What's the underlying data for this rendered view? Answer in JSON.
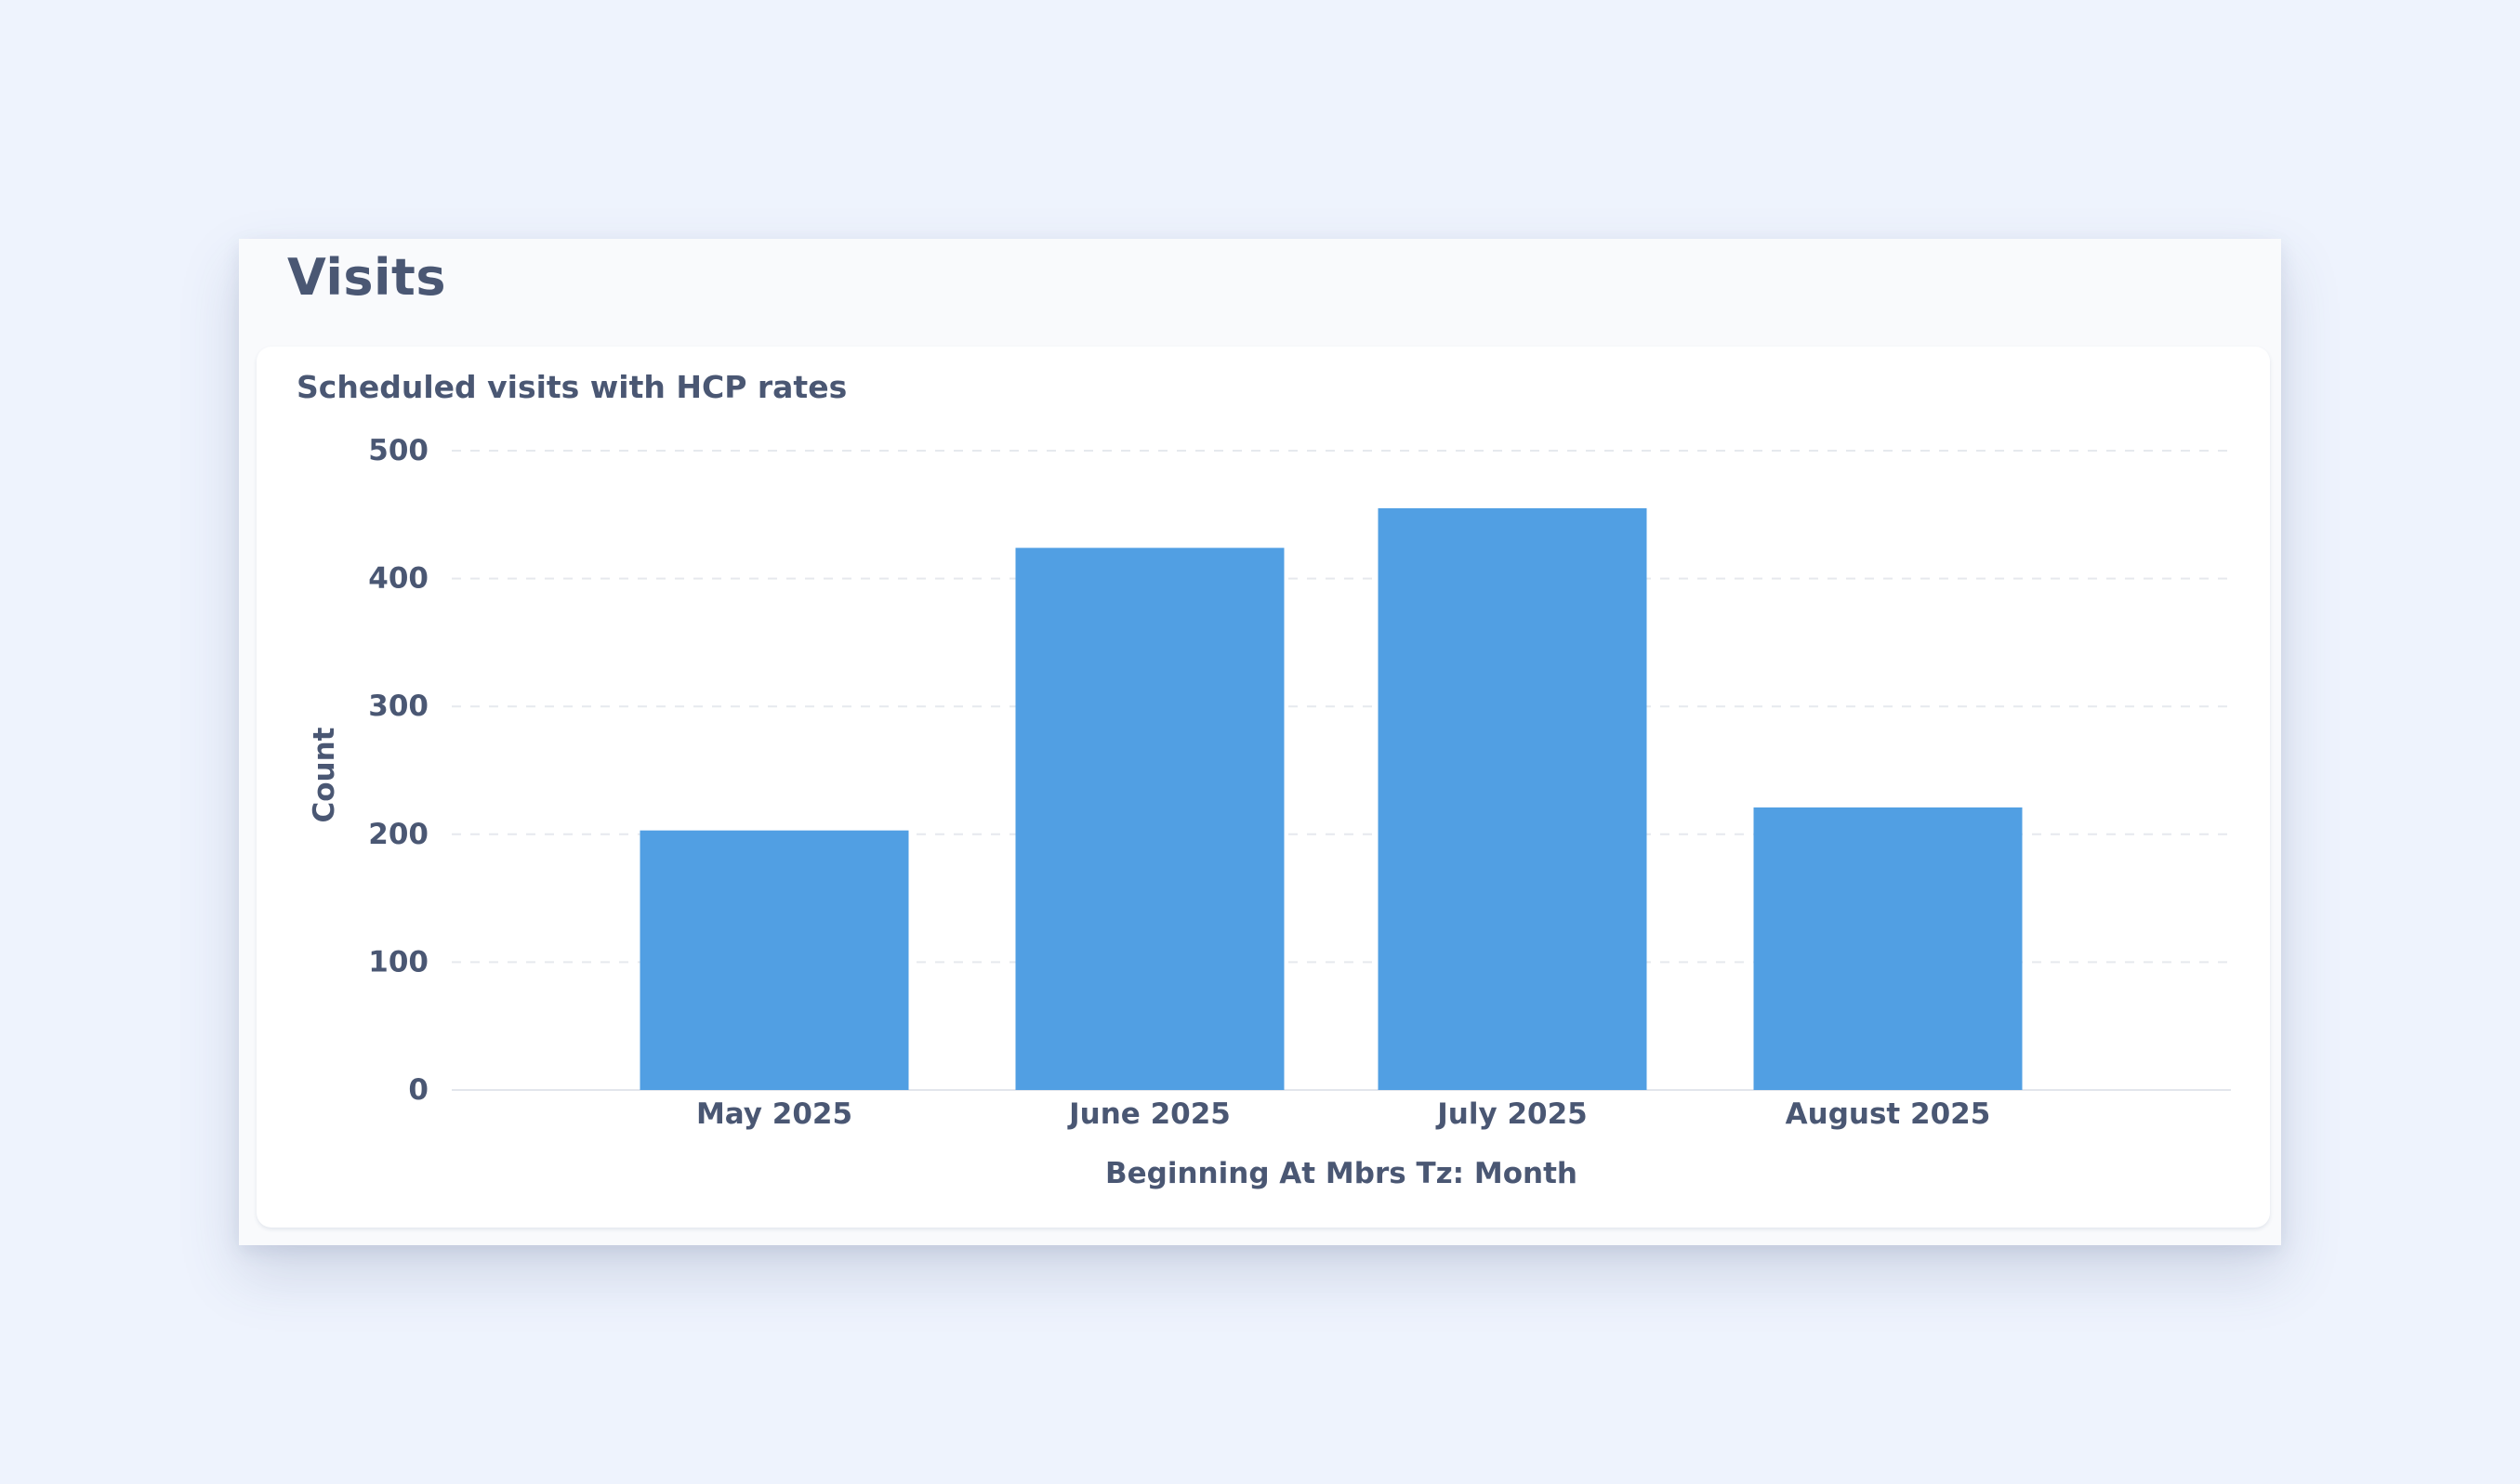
{
  "page": {
    "title": "Visits"
  },
  "card": {
    "title": "Scheduled visits with HCP rates"
  },
  "chart_data": {
    "type": "bar",
    "categories": [
      "May 2025",
      "June 2025",
      "July 2025",
      "August 2025"
    ],
    "values": [
      203,
      424,
      455,
      221
    ],
    "title": "Scheduled visits with HCP rates",
    "xlabel": "Beginning At Mbrs Tz: Month",
    "ylabel": "Count",
    "ylim": [
      0,
      500
    ],
    "yticks": [
      0,
      100,
      200,
      300,
      400,
      500
    ],
    "grid": true,
    "legend": "none",
    "bar_color": "#519fe3"
  }
}
